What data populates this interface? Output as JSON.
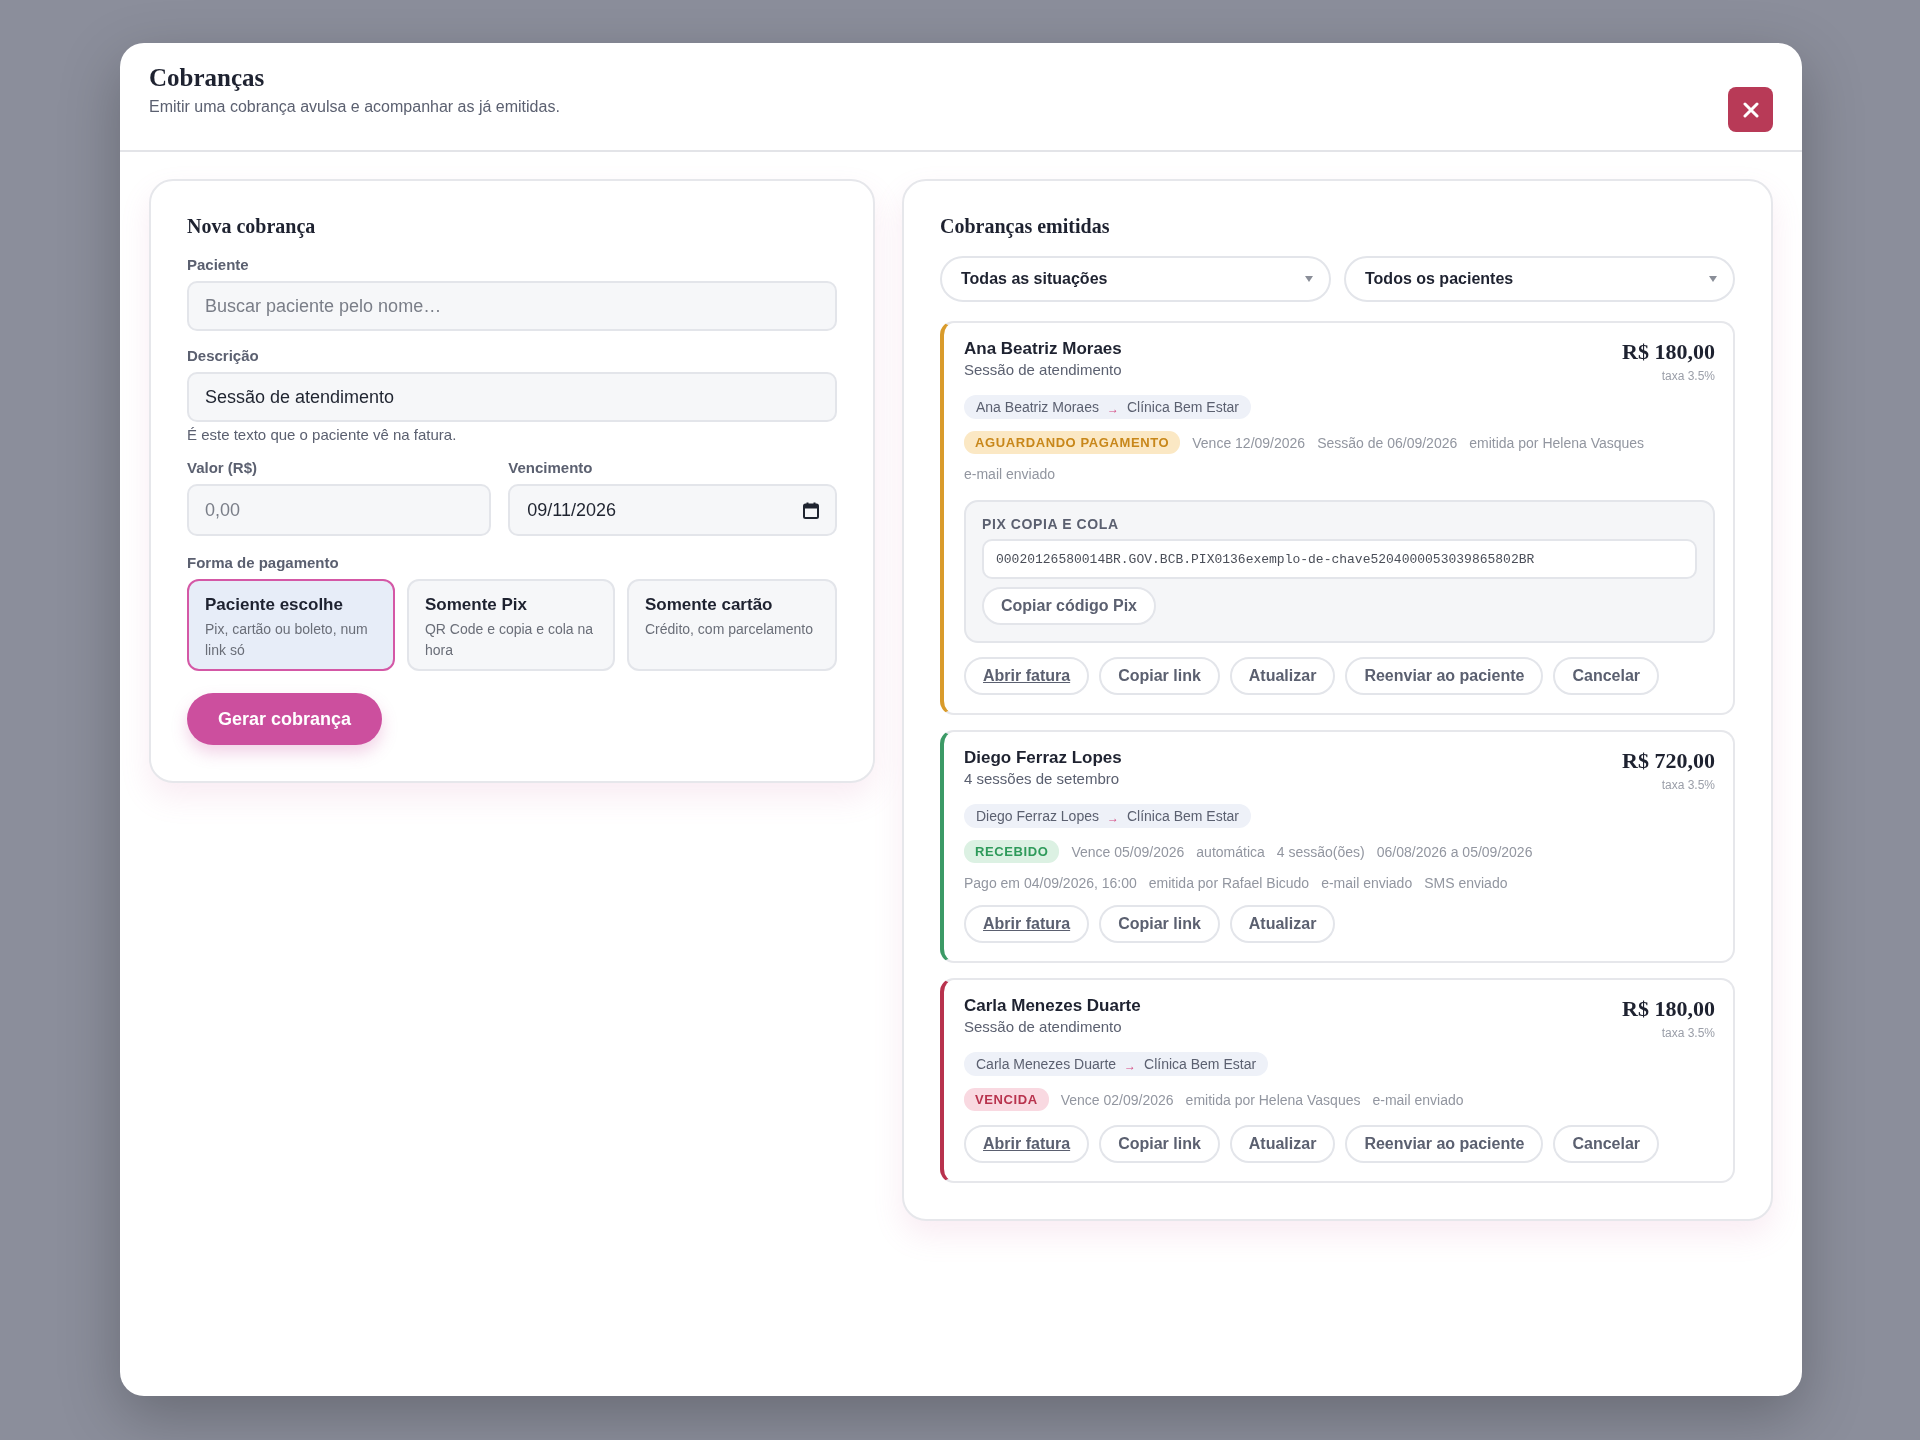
{
  "modal": {
    "title": "Cobranças",
    "subtitle": "Emitir uma cobrança avulsa e acompanhar as já emitidas."
  },
  "new_charge": {
    "title": "Nova cobrança",
    "patient": {
      "label": "Paciente",
      "placeholder": "Buscar paciente pelo nome…"
    },
    "description": {
      "label": "Descrição",
      "value": "Sessão de atendimento",
      "hint": "É este texto que o paciente vê na fatura."
    },
    "amount": {
      "label": "Valor (R$)",
      "placeholder": "0,00"
    },
    "due_date": {
      "label": "Vencimento",
      "value": "09/11/2026"
    },
    "payment_label": "Forma de pagamento",
    "payment_options": [
      {
        "title": "Paciente escolhe",
        "description": "Pix, cartão ou boleto, num link só",
        "selected": true
      },
      {
        "title": "Somente Pix",
        "description": "QR Code e copia e cola na hora",
        "selected": false
      },
      {
        "title": "Somente cartão",
        "description": "Crédito, com parcelamento",
        "selected": false
      }
    ],
    "submit": "Gerar cobrança"
  },
  "issued": {
    "title": "Cobranças emitidas",
    "filters": [
      "Todas as situações",
      "Todos os pacientes"
    ],
    "charges": [
      {
        "patient": "Ana Beatriz Moraes",
        "description": "Sessão de atendimento",
        "amount": "R$ 180,00",
        "fee": "taxa 3.5%",
        "route_from": "Ana Beatriz Moraes",
        "route_arrow": "→",
        "route_to": "Clínica Bem Estar",
        "status": {
          "label": "AGUARDANDO PAGAMENTO",
          "kind": "pending"
        },
        "meta_lines": [
          [
            "Vence 12/09/2026",
            "Sessão de 06/09/2026",
            "emitida por Helena Vasques"
          ],
          [
            "e-mail enviado"
          ]
        ],
        "pix": {
          "label": "PIX COPIA E COLA",
          "code": "00020126580014BR.GOV.BCB.PIX0136exemplo-de-chave5204000053039865802BR",
          "button": "Copiar código Pix"
        },
        "actions": [
          {
            "label": "Abrir fatura",
            "kind": "link"
          },
          {
            "label": "Copiar link",
            "kind": "button"
          },
          {
            "label": "Atualizar",
            "kind": "button"
          },
          {
            "label": "Reenviar ao paciente",
            "kind": "button"
          },
          {
            "label": "Cancelar",
            "kind": "button"
          }
        ]
      },
      {
        "patient": "Diego Ferraz Lopes",
        "description": "4 sessões de setembro",
        "amount": "R$ 720,00",
        "fee": "taxa 3.5%",
        "route_from": "Diego Ferraz Lopes",
        "route_arrow": "→",
        "route_to": "Clínica Bem Estar",
        "status": {
          "label": "RECEBIDO",
          "kind": "received"
        },
        "meta_lines": [
          [
            "Vence 05/09/2026",
            "automática",
            "4 sessão(ões)",
            "06/08/2026 a 05/09/2026"
          ],
          [
            "Pago em 04/09/2026, 16:00",
            "emitida por Rafael Bicudo",
            "e-mail enviado",
            "SMS enviado"
          ]
        ],
        "actions": [
          {
            "label": "Abrir fatura",
            "kind": "link"
          },
          {
            "label": "Copiar link",
            "kind": "button"
          },
          {
            "label": "Atualizar",
            "kind": "button"
          }
        ]
      },
      {
        "patient": "Carla Menezes Duarte",
        "description": "Sessão de atendimento",
        "amount": "R$ 180,00",
        "fee": "taxa 3.5%",
        "route_from": "Carla Menezes Duarte",
        "route_arrow": "→",
        "route_to": "Clínica Bem Estar",
        "status": {
          "label": "VENCIDA",
          "kind": "overdue"
        },
        "meta_lines": [
          [
            "Vence 02/09/2026",
            "emitida por Helena Vasques",
            "e-mail enviado"
          ]
        ],
        "actions": [
          {
            "label": "Abrir fatura",
            "kind": "link"
          },
          {
            "label": "Copiar link",
            "kind": "button"
          },
          {
            "label": "Atualizar",
            "kind": "button"
          },
          {
            "label": "Reenviar ao paciente",
            "kind": "button"
          },
          {
            "label": "Cancelar",
            "kind": "button"
          }
        ]
      }
    ]
  }
}
